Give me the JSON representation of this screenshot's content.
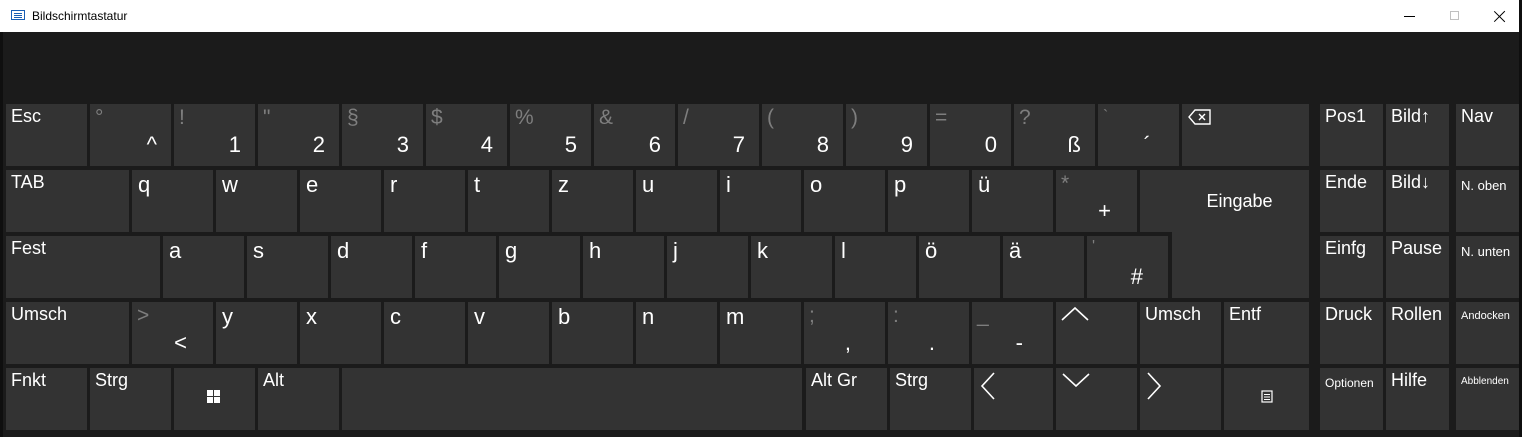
{
  "window": {
    "title": "Bildschirmtastatur",
    "icons": {
      "app": "keyboard-icon",
      "minimize": "minimize-icon",
      "maximize": "maximize-icon",
      "close": "close-icon"
    }
  },
  "keys": {
    "esc": "Esc",
    "circ": {
      "shift": "°",
      "main": "^"
    },
    "d1": {
      "shift": "!",
      "main": "1"
    },
    "d2": {
      "shift": "\"",
      "main": "2"
    },
    "d3": {
      "shift": "§",
      "main": "3"
    },
    "d4": {
      "shift": "$",
      "main": "4"
    },
    "d5": {
      "shift": "%",
      "main": "5"
    },
    "d6": {
      "shift": "&",
      "main": "6"
    },
    "d7": {
      "shift": "/",
      "main": "7"
    },
    "d8": {
      "shift": "(",
      "main": "8"
    },
    "d9": {
      "shift": ")",
      "main": "9"
    },
    "d0": {
      "shift": "=",
      "main": "0"
    },
    "sz": {
      "shift": "?",
      "main": "ß"
    },
    "acute": {
      "shift": "`",
      "main": "´"
    },
    "tab": "TAB",
    "q": "q",
    "w": "w",
    "e": "e",
    "r": "r",
    "t": "t",
    "z": "z",
    "u": "u",
    "i": "i",
    "o": "o",
    "p": "p",
    "ue": "ü",
    "plus": {
      "shift": "*",
      "main": "+"
    },
    "enter": "Eingabe",
    "caps": "Fest",
    "a": "a",
    "s": "s",
    "d": "d",
    "f": "f",
    "g": "g",
    "h": "h",
    "j": "j",
    "k": "k",
    "l": "l",
    "oe": "ö",
    "ae": "ä",
    "hash": {
      "shift": "'",
      "main": "#"
    },
    "lshift": "Umsch",
    "lt": {
      "shift": ">",
      "main": "<"
    },
    "y": "y",
    "x": "x",
    "c": "c",
    "v": "v",
    "b": "b",
    "n": "n",
    "m": "m",
    "comma": {
      "shift": ";",
      "main": ","
    },
    "period": {
      "shift": ":",
      "main": "."
    },
    "minus": {
      "shift": "_",
      "main": "-"
    },
    "rshift": "Umsch",
    "del": "Entf",
    "fn": "Fnkt",
    "lctrl": "Strg",
    "alt": "Alt",
    "altgr": "Alt Gr",
    "rctrl": "Strg",
    "pos1": "Pos1",
    "pgup": "Bild↑",
    "nav": "Nav",
    "end": "Ende",
    "pgdn": "Bild↓",
    "nup": "N. oben",
    "ins": "Einfg",
    "pause": "Pause",
    "ndown": "N. unten",
    "print": "Druck",
    "scroll": "Rollen",
    "dock": "Andocken",
    "options": "Optionen",
    "help": "Hilfe",
    "fade": "Abblenden"
  }
}
